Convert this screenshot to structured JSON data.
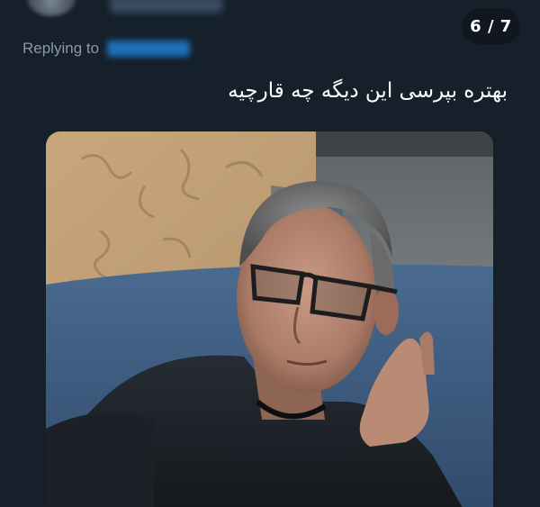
{
  "thread": {
    "counter": "6 / 7"
  },
  "author": {
    "name_blurred": "••••••"
  },
  "reply": {
    "label": "Replying to",
    "handle_blurred": "••••••"
  },
  "tweet": {
    "text": "بهتره بپرسی این دیگه چه قارچیه"
  },
  "media": {
    "description_icon": "photo-icon"
  },
  "colors": {
    "background": "#15202b",
    "secondary_text": "#8b98a5",
    "accent": "#1d9bf0",
    "text": "#ffffff"
  }
}
